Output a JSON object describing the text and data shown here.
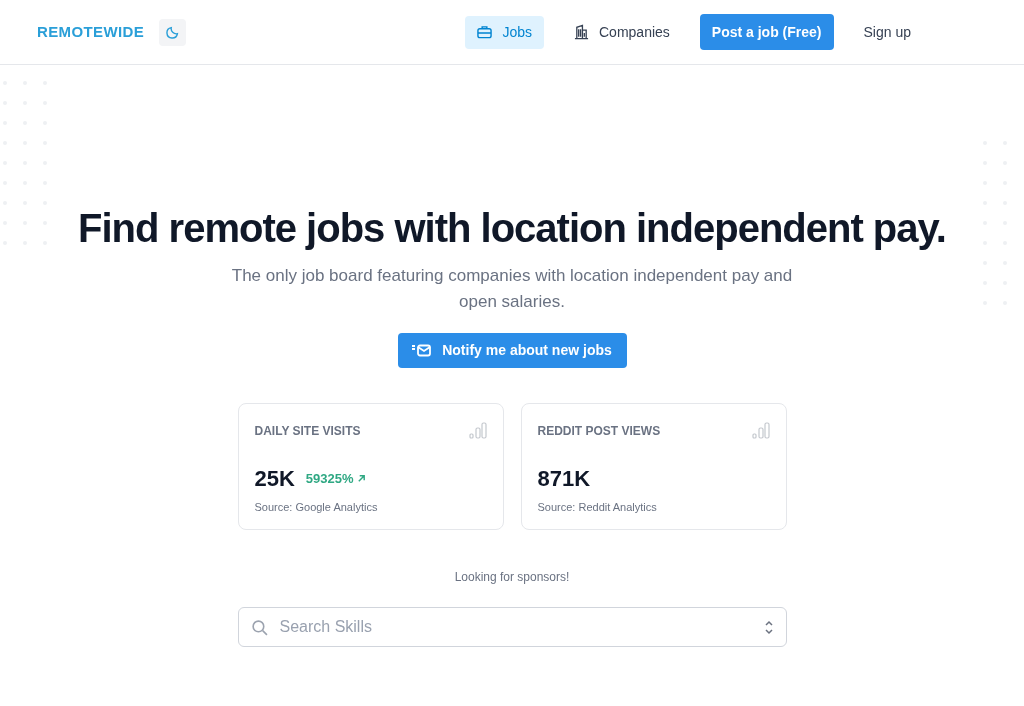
{
  "logo": "REMOTEWIDE",
  "nav": [
    {
      "label": "Jobs",
      "kind": "link",
      "selected": true
    },
    {
      "label": "Companies",
      "kind": "link",
      "selected": false
    },
    {
      "label": "Post a job (Free)",
      "kind": "primary",
      "selected": false
    },
    {
      "label": "Sign up",
      "kind": "link",
      "selected": false
    }
  ],
  "hero": {
    "title": "Find remote jobs with location independent pay.",
    "subtitle": "The only job board featuring companies with location independent pay and open salaries.",
    "button": "Notify me about new jobs"
  },
  "stats": [
    {
      "label": "DAILY SITE VISITS",
      "value": "25K",
      "change": "59325%",
      "source": "Source: Google Analytics"
    },
    {
      "label": "REDDIT POST VIEWS",
      "value": "871K",
      "source": "Source: Reddit Analytics"
    }
  ],
  "sponsors": "Looking for sponsors!",
  "search": {
    "placeholder": "Search Skills"
  }
}
